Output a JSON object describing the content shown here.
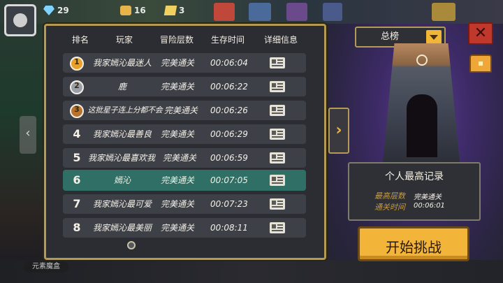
{
  "hud": {
    "gems": "29",
    "materials": "16",
    "cards": "3"
  },
  "leaderboard": {
    "headers": {
      "rank": "排名",
      "player": "玩家",
      "floor": "冒险层数",
      "time": "生存时间",
      "detail": "详细信息"
    },
    "rows": [
      {
        "rank": "1",
        "player": "我家嫣沁最迷人",
        "floor": "完美通关",
        "time": "00:06:04",
        "medal": "gold"
      },
      {
        "rank": "2",
        "player": "鹿",
        "floor": "完美通关",
        "time": "00:06:22",
        "medal": "silver"
      },
      {
        "rank": "3",
        "player": "这批星子连上分都不会",
        "floor": "完美通关",
        "time": "00:06:26",
        "medal": "bronze"
      },
      {
        "rank": "4",
        "player": "我家嫣沁最善良",
        "floor": "完美通关",
        "time": "00:06:29"
      },
      {
        "rank": "5",
        "player": "我家嫣沁最喜欢我",
        "floor": "完美通关",
        "time": "00:06:59"
      },
      {
        "rank": "6",
        "player": "嫣沁",
        "floor": "完美通关",
        "time": "00:07:05",
        "highlight": true
      },
      {
        "rank": "7",
        "player": "我家嫣沁最可爱",
        "floor": "完美通关",
        "time": "00:07:23"
      },
      {
        "rank": "8",
        "player": "我家嫣沁最美丽",
        "floor": "完美通关",
        "time": "00:08:11"
      }
    ]
  },
  "filter": {
    "selected": "总榜"
  },
  "personal_best": {
    "title": "个人最高记录",
    "floor_label": "最高层数",
    "floor_value": "完美通关",
    "time_label": "通关时间",
    "time_value": "00:06:01"
  },
  "start_button": "开始挑战",
  "bottom_label": "元素魔盒",
  "colors": {
    "gold": "#e8a22a",
    "silver": "#9aa0a8",
    "bronze": "#b8742f",
    "accent": "#f3b43a",
    "highlight_row": "#2f6f66"
  },
  "icons": {
    "close": "close-icon",
    "dropdown": "chevron-down-icon",
    "next": "chevron-right-icon",
    "prev": "chevron-left-icon",
    "detail": "id-card-icon",
    "chest": "treasure-chest-icon"
  }
}
